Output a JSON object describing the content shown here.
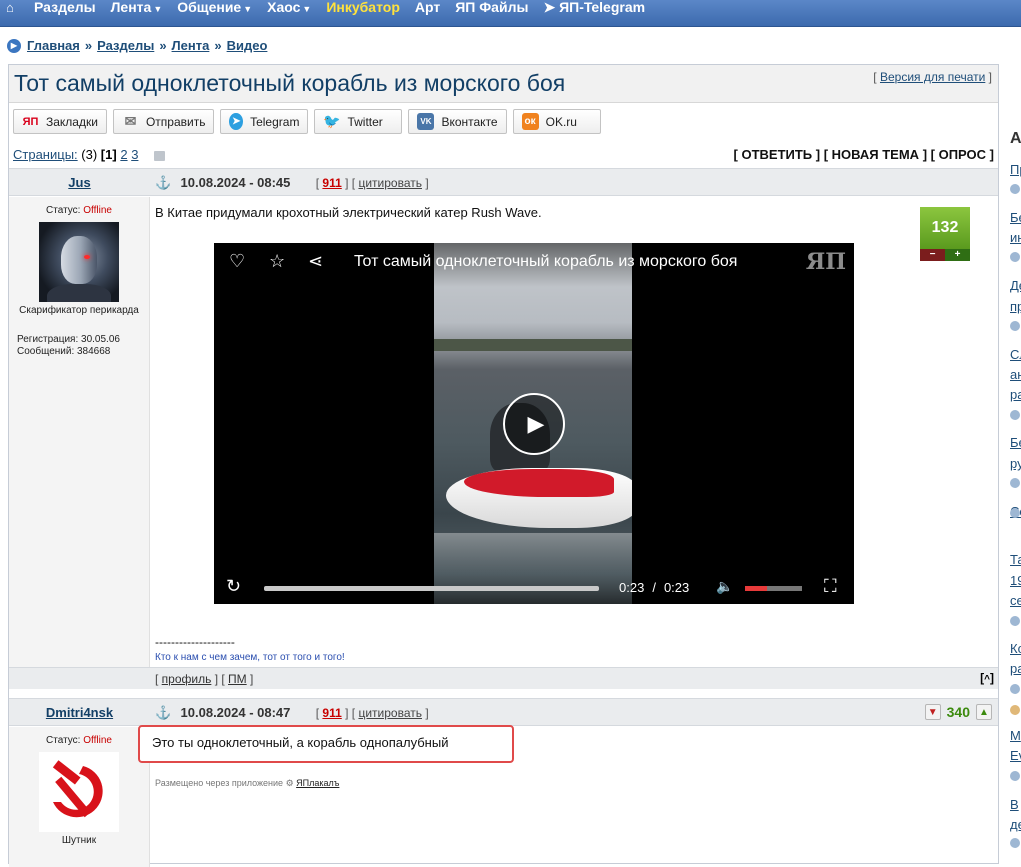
{
  "topnav": {
    "items": [
      "Разделы",
      "Лента",
      "Общение",
      "Хаос",
      "Инкубатор",
      "Арт",
      "ЯП Файлы",
      "ЯП-Telegram"
    ]
  },
  "breadcrumb": [
    "Главная",
    "Разделы",
    "Лента",
    "Видео"
  ],
  "topic": {
    "title": "Тот самый одноклеточный корабль из морского боя",
    "print_label": "Версия для печати"
  },
  "share": [
    "Закладки",
    "Отправить",
    "Telegram",
    "Twitter",
    "Вконтакте",
    "OK.ru"
  ],
  "pagination": {
    "label": "Страницы:",
    "count": "(3)",
    "current": "1",
    "pages": [
      "2",
      "3"
    ]
  },
  "actions": {
    "reply": "ОТВЕТИТЬ",
    "new_topic": "НОВАЯ ТЕМА",
    "poll": "ОПРОС"
  },
  "post1": {
    "author": "Jus",
    "date": "10.08.2024 - 08:45",
    "num": "911",
    "cite": "цитировать",
    "status_label": "Статус:",
    "status": "Offline",
    "rank": "Скарификатор перикарда",
    "reg": "Регистрация: 30.05.06",
    "msgs": "Сообщений: 384668",
    "text": "В Китае придумали крохотный электрический катер Rush Wave.",
    "rating": "132",
    "video": {
      "title": "Тот самый одноклеточный корабль из морского боя",
      "time_current": "0:23",
      "time_total": "0:23",
      "logo": "ЯП"
    },
    "sig_line": "--------------------",
    "sig_text": "Кто к нам с чем зачем, тот от того и того!",
    "profile": "профиль",
    "pm": "ПМ"
  },
  "post2": {
    "author": "Dmitri4nsk",
    "date": "10.08.2024 - 08:47",
    "num": "911",
    "cite": "цитировать",
    "status_label": "Статус:",
    "status": "Offline",
    "rank": "Шутник",
    "rating": "340",
    "text": "Это ты одноклеточный, а корабль однопалубный",
    "via_label": "Размещено через приложение",
    "via_app": "ЯПлакалъ"
  },
  "sidebar": {
    "heading": "А",
    "items": [
      "Пр",
      "Бе",
      "ин",
      "Де",
      "пр",
      "Сл",
      "ан",
      "ра",
      "Бе",
      "ру",
      "Се",
      "Та",
      "19",
      "се",
      "Ко",
      "ра",
      "М",
      "Ev",
      "В",
      "де"
    ]
  }
}
